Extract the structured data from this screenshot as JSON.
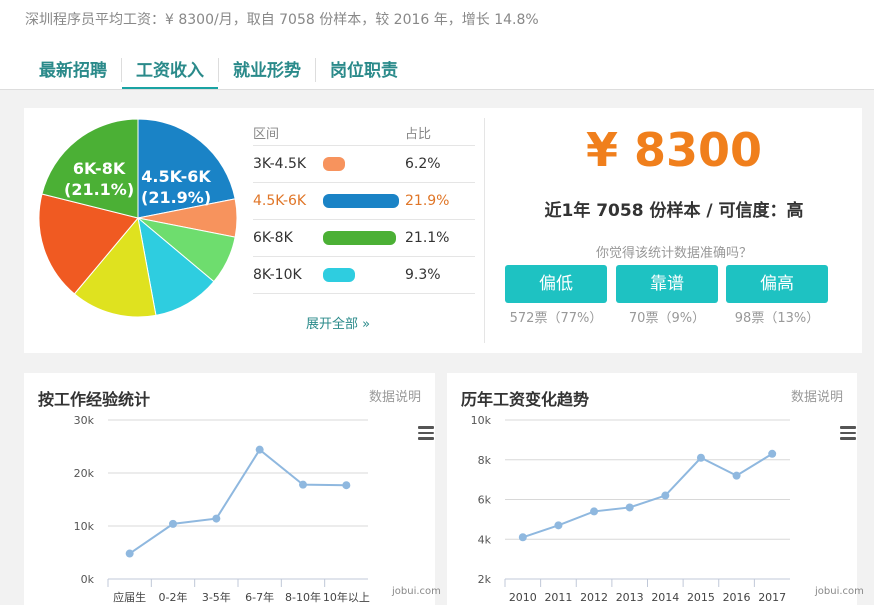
{
  "headline": "深圳程序员平均工资：¥ 8300/月，取自 7058 份样本，较 2016 年，增长 14.8%",
  "tabs": [
    {
      "label": "最新招聘"
    },
    {
      "label": "工资收入"
    },
    {
      "label": "就业形势"
    },
    {
      "label": "岗位职责"
    }
  ],
  "pie": {
    "labels": [
      {
        "range": "6K-8K",
        "pct": "(21.1%)"
      },
      {
        "range": "4.5K-6K",
        "pct": "(21.9%)"
      }
    ],
    "slices": [
      {
        "name": "4.5K-6K",
        "value": 21.9,
        "color": "#1a83c6"
      },
      {
        "name": "3K-4.5K",
        "value": 6.2,
        "color": "#f7935d"
      },
      {
        "name": "unlabeled-1",
        "value": 8.0,
        "color": "#6edd6e"
      },
      {
        "name": "unlabeled-2",
        "value": 11.0,
        "color": "#2ecde0"
      },
      {
        "name": "unlabeled-3",
        "value": 14.0,
        "color": "#dfe21f"
      },
      {
        "name": "unlabeled-4",
        "value": 17.8,
        "color": "#f05a22"
      },
      {
        "name": "6K-8K",
        "value": 21.1,
        "color": "#4bb035"
      }
    ]
  },
  "range_table": {
    "headers": {
      "range": "区间",
      "share": "占比"
    },
    "rows": [
      {
        "range": "3K-4.5K",
        "pct": "6.2%",
        "value": 6.2,
        "color": "#f7935d",
        "highlight": false
      },
      {
        "range": "4.5K-6K",
        "pct": "21.9%",
        "value": 21.9,
        "color": "#1a83c6",
        "highlight": true
      },
      {
        "range": "6K-8K",
        "pct": "21.1%",
        "value": 21.1,
        "color": "#4bb035",
        "highlight": false
      },
      {
        "range": "8K-10K",
        "pct": "9.3%",
        "value": 9.3,
        "color": "#2ecde0",
        "highlight": false
      }
    ],
    "expand": "展开全部 »"
  },
  "salary": {
    "amount": "¥ 8300",
    "sample_info": "近1年 7058 份样本 / 可信度：高",
    "question": "你觉得该统计数据准确吗？",
    "votes": [
      {
        "label": "偏低",
        "count": "572票（77%）"
      },
      {
        "label": "靠谱",
        "count": "70票（9%）"
      },
      {
        "label": "偏高",
        "count": "98票（13%）"
      }
    ]
  },
  "charts": {
    "experience": {
      "title": "按工作经验统计",
      "note": "数据说明",
      "watermark": "jobui.com"
    },
    "trend": {
      "title": "历年工资变化趋势",
      "note": "数据说明",
      "watermark": "jobui.com"
    }
  },
  "chart_data": [
    {
      "type": "line",
      "title": "按工作经验统计",
      "categories": [
        "应届生",
        "0-2年",
        "3-5年",
        "6-7年",
        "8-10年",
        "10年以上"
      ],
      "values": [
        4800,
        10400,
        11400,
        24400,
        17800,
        17700
      ],
      "yticks": [
        "0k",
        "10k",
        "20k",
        "30k"
      ],
      "ylim": [
        0,
        30000
      ],
      "grid": true,
      "color": "#8fb8df"
    },
    {
      "type": "line",
      "title": "历年工资变化趋势",
      "categories": [
        "2010",
        "2011",
        "2012",
        "2013",
        "2014",
        "2015",
        "2016",
        "2017"
      ],
      "values": [
        4100,
        4700,
        5400,
        5600,
        6200,
        8100,
        7200,
        8300
      ],
      "yticks": [
        "2k",
        "4k",
        "6k",
        "8k",
        "10k"
      ],
      "ylim": [
        2000,
        10000
      ],
      "grid": true,
      "color": "#8fb8df"
    }
  ]
}
